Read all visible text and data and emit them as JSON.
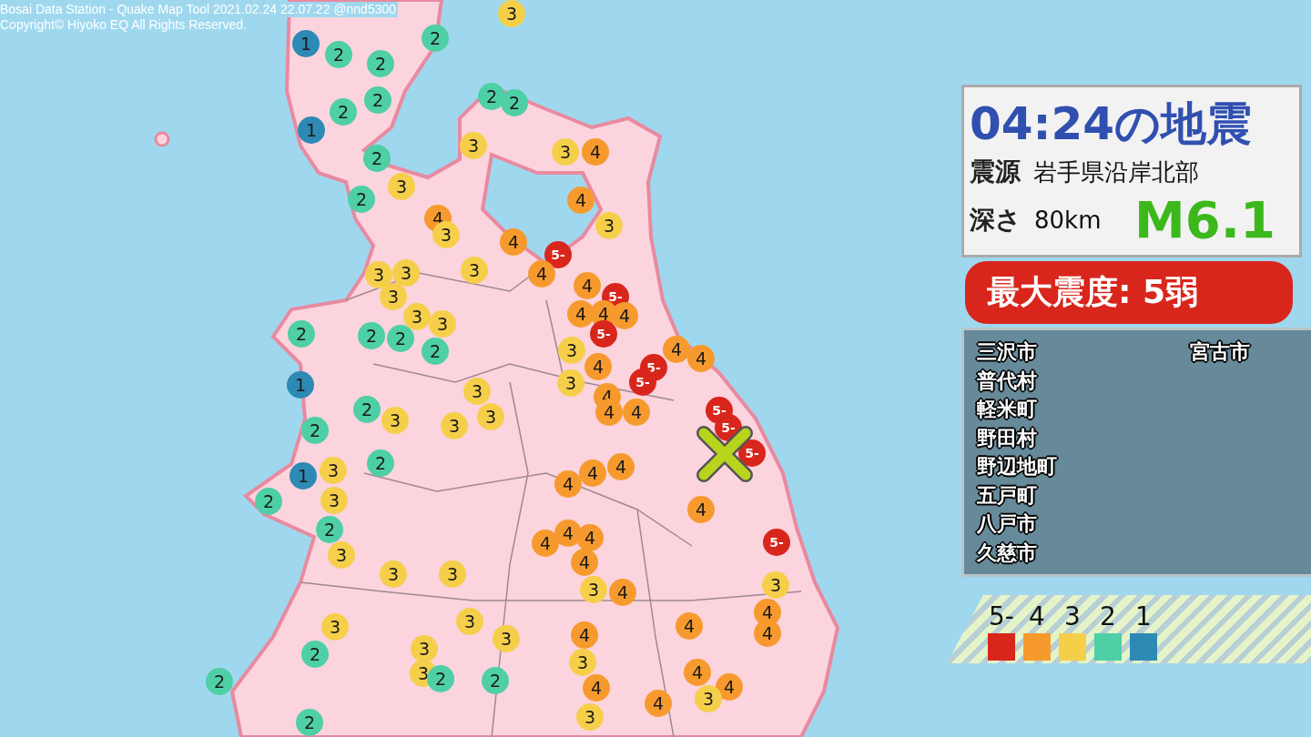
{
  "header": {
    "line_1": "Bosai Data Station - Quake Map Tool 2021.02.24 22.07.22 @nnd5300",
    "line_2": "Copyright© Hiyoko EQ All Rights Reserved."
  },
  "quake": {
    "title": "04:24の地震",
    "epicenter_label": "震源",
    "epicenter": "岩手県沿岸北部",
    "depth_label": "深さ",
    "depth": "80km",
    "magnitude": "M6.1"
  },
  "max_intensity": "最大震度: 5弱",
  "areas": {
    "column_1": [
      "三沢市",
      "普代村",
      "軽米町",
      "野田村",
      "野辺地町",
      "五戸町",
      "八戸市",
      "久慈市"
    ],
    "column_2": [
      "宮古市"
    ]
  },
  "legend": [
    {
      "label": "5-",
      "color": "#d9261c"
    },
    {
      "label": "4",
      "color": "#f79a2e"
    },
    {
      "label": "3",
      "color": "#f6cf4a"
    },
    {
      "label": "2",
      "color": "#4ecfa6"
    },
    {
      "label": "1",
      "color": "#2d8ab5"
    }
  ],
  "markers": [
    {
      "label": "3",
      "color": "#f6cf4a"
    },
    {
      "label": "2",
      "color": "#4ecfa6"
    },
    {
      "label": "1",
      "color": "#2d8ab5"
    },
    {
      "label": "2",
      "color": "#4ecfa6"
    },
    {
      "label": "2",
      "color": "#4ecfa6"
    },
    {
      "label": "2",
      "color": "#4ecfa6"
    },
    {
      "label": "2",
      "color": "#4ecfa6"
    },
    {
      "label": "2",
      "color": "#4ecfa6"
    },
    {
      "label": "2",
      "color": "#4ecfa6"
    },
    {
      "label": "1",
      "color": "#2d8ab5"
    },
    {
      "label": "3",
      "color": "#f6cf4a"
    },
    {
      "label": "3",
      "color": "#f6cf4a"
    },
    {
      "label": "4",
      "color": "#f79a2e"
    },
    {
      "label": "2",
      "color": "#4ecfa6"
    },
    {
      "label": "3",
      "color": "#f6cf4a"
    },
    {
      "label": "2",
      "color": "#4ecfa6"
    },
    {
      "label": "4",
      "color": "#f79a2e"
    },
    {
      "label": "4",
      "color": "#f79a2e"
    },
    {
      "label": "3",
      "color": "#f6cf4a"
    },
    {
      "label": "3",
      "color": "#f6cf4a"
    },
    {
      "label": "4",
      "color": "#f79a2e"
    },
    {
      "label": "5-",
      "color": "#d9261c"
    },
    {
      "label": "3",
      "color": "#f6cf4a"
    },
    {
      "label": "3",
      "color": "#f6cf4a"
    },
    {
      "label": "3",
      "color": "#f6cf4a"
    },
    {
      "label": "4",
      "color": "#f79a2e"
    },
    {
      "label": "3",
      "color": "#f6cf4a"
    },
    {
      "label": "4",
      "color": "#f79a2e"
    },
    {
      "label": "5-",
      "color": "#d9261c"
    },
    {
      "label": "3",
      "color": "#f6cf4a"
    },
    {
      "label": "3",
      "color": "#f6cf4a"
    },
    {
      "label": "4",
      "color": "#f79a2e"
    },
    {
      "label": "4",
      "color": "#f79a2e"
    },
    {
      "label": "4",
      "color": "#f79a2e"
    },
    {
      "label": "2",
      "color": "#4ecfa6"
    },
    {
      "label": "2",
      "color": "#4ecfa6"
    },
    {
      "label": "2",
      "color": "#4ecfa6"
    },
    {
      "label": "5-",
      "color": "#d9261c"
    },
    {
      "label": "2",
      "color": "#4ecfa6"
    },
    {
      "label": "3",
      "color": "#f6cf4a"
    },
    {
      "label": "4",
      "color": "#f79a2e"
    },
    {
      "label": "4",
      "color": "#f79a2e"
    },
    {
      "label": "4",
      "color": "#f79a2e"
    },
    {
      "label": "5-",
      "color": "#d9261c"
    },
    {
      "label": "1",
      "color": "#2d8ab5"
    },
    {
      "label": "3",
      "color": "#f6cf4a"
    },
    {
      "label": "3",
      "color": "#f6cf4a"
    },
    {
      "label": "4",
      "color": "#f79a2e"
    },
    {
      "label": "5-",
      "color": "#d9261c"
    },
    {
      "label": "2",
      "color": "#4ecfa6"
    },
    {
      "label": "2",
      "color": "#4ecfa6"
    },
    {
      "label": "3",
      "color": "#f6cf4a"
    },
    {
      "label": "3",
      "color": "#f6cf4a"
    },
    {
      "label": "3",
      "color": "#f6cf4a"
    },
    {
      "label": "4",
      "color": "#f79a2e"
    },
    {
      "label": "4",
      "color": "#f79a2e"
    },
    {
      "label": "5-",
      "color": "#d9261c"
    },
    {
      "label": "5-",
      "color": "#d9261c"
    },
    {
      "label": "5-",
      "color": "#d9261c"
    },
    {
      "label": "1",
      "color": "#2d8ab5"
    },
    {
      "label": "3",
      "color": "#f6cf4a"
    },
    {
      "label": "2",
      "color": "#4ecfa6"
    },
    {
      "label": "4",
      "color": "#f79a2e"
    },
    {
      "label": "4",
      "color": "#f79a2e"
    },
    {
      "label": "4",
      "color": "#f79a2e"
    },
    {
      "label": "2",
      "color": "#4ecfa6"
    },
    {
      "label": "3",
      "color": "#f6cf4a"
    },
    {
      "label": "4",
      "color": "#f79a2e"
    },
    {
      "label": "2",
      "color": "#4ecfa6"
    },
    {
      "label": "4",
      "color": "#f79a2e"
    },
    {
      "label": "4",
      "color": "#f79a2e"
    },
    {
      "label": "4",
      "color": "#f79a2e"
    },
    {
      "label": "5-",
      "color": "#d9261c"
    },
    {
      "label": "3",
      "color": "#f6cf4a"
    },
    {
      "label": "4",
      "color": "#f79a2e"
    },
    {
      "label": "3",
      "color": "#f6cf4a"
    },
    {
      "label": "3",
      "color": "#f6cf4a"
    },
    {
      "label": "3",
      "color": "#f6cf4a"
    },
    {
      "label": "4",
      "color": "#f79a2e"
    },
    {
      "label": "3",
      "color": "#f6cf4a"
    },
    {
      "label": "4",
      "color": "#f79a2e"
    },
    {
      "label": "3",
      "color": "#f6cf4a"
    },
    {
      "label": "3",
      "color": "#f6cf4a"
    },
    {
      "label": "3",
      "color": "#f6cf4a"
    },
    {
      "label": "4",
      "color": "#f79a2e"
    },
    {
      "label": "4",
      "color": "#f79a2e"
    },
    {
      "label": "4",
      "color": "#f79a2e"
    },
    {
      "label": "2",
      "color": "#4ecfa6"
    },
    {
      "label": "3",
      "color": "#f6cf4a"
    },
    {
      "label": "3",
      "color": "#f6cf4a"
    },
    {
      "label": "2",
      "color": "#4ecfa6"
    },
    {
      "label": "3",
      "color": "#f6cf4a"
    },
    {
      "label": "2",
      "color": "#4ecfa6"
    },
    {
      "label": "2",
      "color": "#4ecfa6"
    },
    {
      "label": "4",
      "color": "#f79a2e"
    },
    {
      "label": "4",
      "color": "#f79a2e"
    },
    {
      "label": "4",
      "color": "#f79a2e"
    },
    {
      "label": "4",
      "color": "#f79a2e"
    },
    {
      "label": "3",
      "color": "#f6cf4a"
    },
    {
      "label": "2",
      "color": "#4ecfa6"
    },
    {
      "label": "3",
      "color": "#f6cf4a"
    }
  ]
}
